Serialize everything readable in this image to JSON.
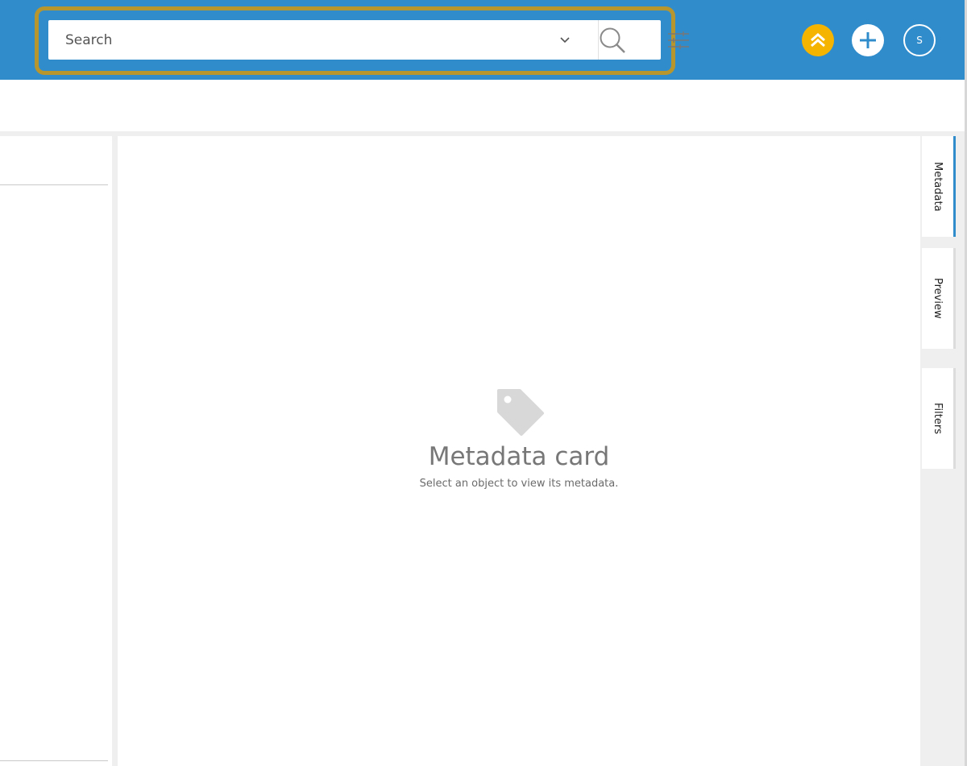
{
  "search": {
    "placeholder": "Search"
  },
  "header": {
    "user_initial": "S"
  },
  "card": {
    "title": "Metadata card",
    "subtitle": "Select an object to view its metadata."
  },
  "right_tabs": [
    {
      "label": "Metadata"
    },
    {
      "label": "Preview"
    },
    {
      "label": "Filters"
    }
  ],
  "colors": {
    "topbar": "#318ccb",
    "highlight": "#b8962e",
    "accent_yellow": "#f5b400"
  }
}
